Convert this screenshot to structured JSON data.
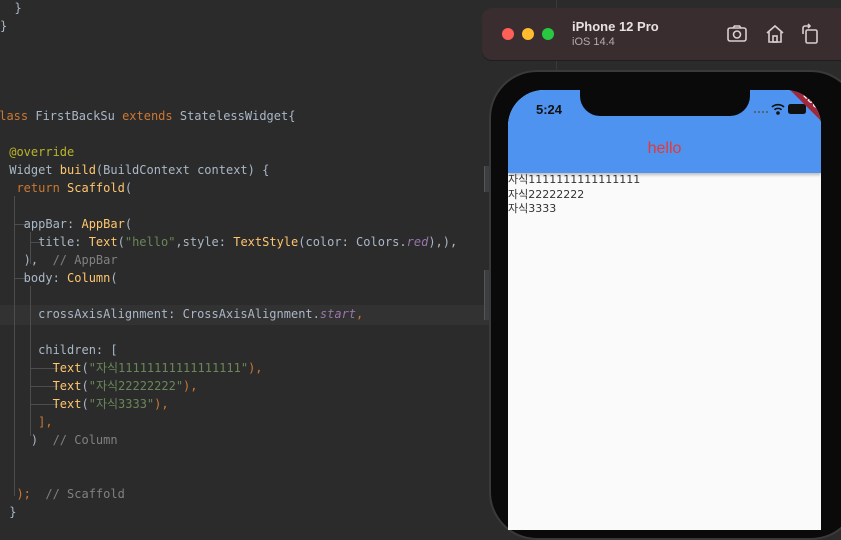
{
  "editor": {
    "lines": [
      {
        "id": "l1",
        "parts": [
          {
            "t": "  }",
            "c": "lbl"
          }
        ]
      },
      {
        "id": "l2",
        "parts": [
          {
            "t": "}",
            "c": "lbl"
          }
        ]
      },
      {
        "id": "l3",
        "parts": [
          {
            "t": "class ",
            "c": "kw"
          },
          {
            "t": "FirstBackSu ",
            "c": "lbl"
          },
          {
            "t": "extends ",
            "c": "kw"
          },
          {
            "t": "StatelessWidget{",
            "c": "lbl"
          }
        ]
      },
      {
        "id": "l4",
        "parts": [
          {
            "t": " @override",
            "c": "ann"
          }
        ]
      },
      {
        "id": "l5",
        "parts": [
          {
            "t": " Widget ",
            "c": "lbl"
          },
          {
            "t": "build",
            "c": "meth"
          },
          {
            "t": "(BuildContext context) {",
            "c": "lbl"
          }
        ]
      },
      {
        "id": "l6",
        "parts": [
          {
            "t": "  ",
            "c": "lbl"
          },
          {
            "t": "return ",
            "c": "kw"
          },
          {
            "t": "Scaffold",
            "c": "cls"
          },
          {
            "t": "(",
            "c": "lbl"
          }
        ]
      },
      {
        "id": "l7",
        "parts": [
          {
            "t": "   appBar: ",
            "c": "lbl"
          },
          {
            "t": "AppBar",
            "c": "cls"
          },
          {
            "t": "(",
            "c": "lbl"
          }
        ]
      },
      {
        "id": "l8",
        "parts": [
          {
            "t": "     title: ",
            "c": "lbl"
          },
          {
            "t": "Text",
            "c": "cls"
          },
          {
            "t": "(",
            "c": "lbl"
          },
          {
            "t": "\"hello\"",
            "c": "str"
          },
          {
            "t": ",style: ",
            "c": "lbl"
          },
          {
            "t": "TextStyle",
            "c": "cls"
          },
          {
            "t": "(color: Colors.",
            "c": "lbl"
          },
          {
            "t": "red",
            "c": "prop"
          },
          {
            "t": "),),",
            "c": "lbl"
          }
        ]
      },
      {
        "id": "l9",
        "parts": [
          {
            "t": "   ),  ",
            "c": "lbl"
          },
          {
            "t": "// AppBar",
            "c": "cmt"
          }
        ]
      },
      {
        "id": "l10",
        "parts": [
          {
            "t": "   body: ",
            "c": "lbl"
          },
          {
            "t": "Column",
            "c": "cls"
          },
          {
            "t": "(",
            "c": "lbl"
          }
        ]
      },
      {
        "id": "l11",
        "parts": [
          {
            "t": "     crossAxisAlignment: CrossAxisAlignment.",
            "c": "lbl"
          },
          {
            "t": "start",
            "c": "prop"
          },
          {
            "t": ",",
            "c": "kw"
          }
        ]
      },
      {
        "id": "l12",
        "parts": [
          {
            "t": "     children: [",
            "c": "lbl"
          }
        ]
      },
      {
        "id": "l13",
        "parts": [
          {
            "t": "       ",
            "c": "lbl"
          },
          {
            "t": "Text",
            "c": "cls"
          },
          {
            "t": "(",
            "c": "lbl"
          },
          {
            "t": "\"자식11111111111111111\"",
            "c": "str"
          },
          {
            "t": "),",
            "c": "kw"
          }
        ]
      },
      {
        "id": "l14",
        "parts": [
          {
            "t": "       ",
            "c": "lbl"
          },
          {
            "t": "Text",
            "c": "cls"
          },
          {
            "t": "(",
            "c": "lbl"
          },
          {
            "t": "\"자식22222222\"",
            "c": "str"
          },
          {
            "t": "),",
            "c": "kw"
          }
        ]
      },
      {
        "id": "l15",
        "parts": [
          {
            "t": "       ",
            "c": "lbl"
          },
          {
            "t": "Text",
            "c": "cls"
          },
          {
            "t": "(",
            "c": "lbl"
          },
          {
            "t": "\"자식3333\"",
            "c": "str"
          },
          {
            "t": "),",
            "c": "kw"
          }
        ]
      },
      {
        "id": "l16",
        "parts": [
          {
            "t": "     ],",
            "c": "kw"
          }
        ]
      },
      {
        "id": "l17",
        "parts": [
          {
            "t": "    )  ",
            "c": "lbl"
          },
          {
            "t": "// Column",
            "c": "cmt"
          }
        ]
      },
      {
        "id": "l18",
        "parts": [
          {
            "t": "  );  ",
            "c": "kw"
          },
          {
            "t": "// Scaffold",
            "c": "cmt"
          }
        ]
      },
      {
        "id": "l19",
        "parts": [
          {
            "t": " }",
            "c": "lbl"
          }
        ]
      }
    ]
  },
  "simulator": {
    "device": "iPhone 12 Pro",
    "os": "iOS 14.4",
    "icons": [
      "screenshot-icon",
      "home-icon",
      "rotate-icon"
    ]
  },
  "app": {
    "status_time": "5:24",
    "appbar_title": "hello",
    "debug_banner": "DEBUG",
    "body_texts": [
      "자식1111111111111111",
      "자식22222222",
      "자식3333"
    ]
  },
  "colors": {
    "appbar": "#4e93ef",
    "title": "#e53935",
    "editor_bg": "#2b2b2b",
    "keyword": "#cc7832",
    "class": "#ffc66d",
    "string": "#6a8759"
  }
}
